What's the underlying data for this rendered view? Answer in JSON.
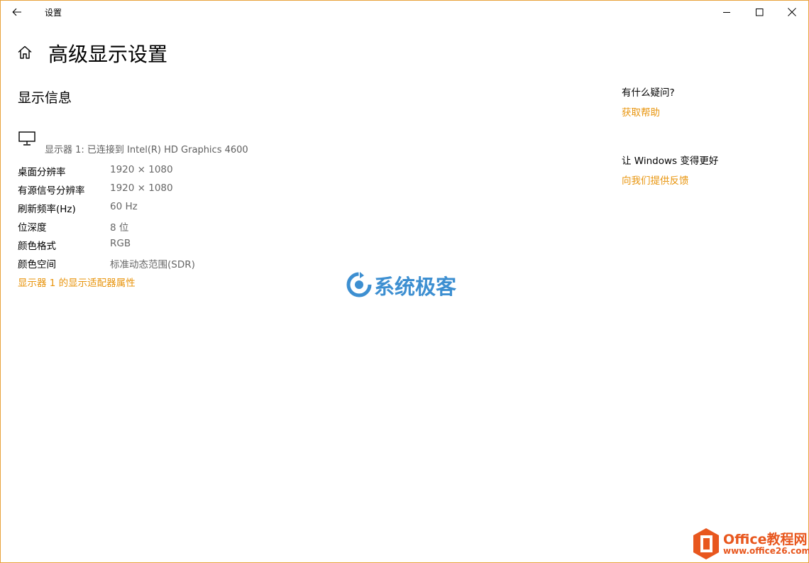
{
  "window": {
    "title": "设置"
  },
  "page": {
    "title": "高级显示设置",
    "section_title": "显示信息"
  },
  "display": {
    "name": "显示器 1: 已连接到 Intel(R) HD Graphics 4600",
    "rows": [
      {
        "label": "桌面分辨率",
        "value": "1920 × 1080"
      },
      {
        "label": "有源信号分辨率",
        "value": "1920 × 1080"
      },
      {
        "label": "刷新频率(Hz)",
        "value": "60 Hz"
      },
      {
        "label": "位深度",
        "value": "8 位"
      },
      {
        "label": "颜色格式",
        "value": "RGB"
      },
      {
        "label": "颜色空间",
        "value": "标准动态范围(SDR)"
      }
    ],
    "adapter_link": "显示器 1 的显示适配器属性"
  },
  "sidebar": {
    "help_title": "有什么疑问?",
    "help_link": "获取帮助",
    "feedback_title": "让 Windows 变得更好",
    "feedback_link": "向我们提供反馈"
  },
  "watermarks": {
    "center_text": "系统极客",
    "corner_title": "Office教程网",
    "corner_url": "www.office26.com"
  },
  "colors": {
    "accent": "#e8940c",
    "window_border": "#e8a33d",
    "secondary_text": "#666666"
  },
  "icons": {
    "back": "back-arrow-icon",
    "home": "home-icon",
    "monitor": "monitor-icon",
    "minimize": "minimize-icon",
    "maximize": "maximize-icon",
    "close": "close-icon"
  }
}
